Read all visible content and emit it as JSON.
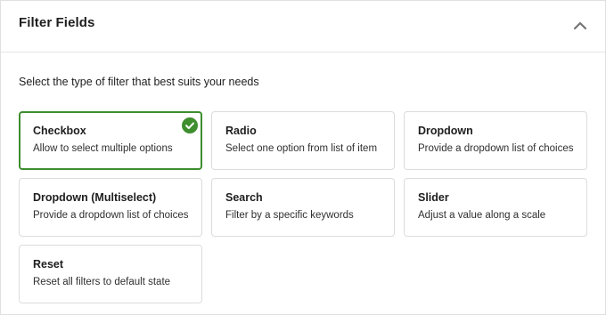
{
  "panel": {
    "title": "Filter Fields",
    "toggle_icon": "chevron-up-icon"
  },
  "intro_text": "Select the type of filter that best suits your needs",
  "selected_filter": "Checkbox",
  "colors": {
    "selected_border": "#3e8e2f",
    "check_badge": "#3e8e2f",
    "card_border": "#dcdcdc"
  },
  "filters": [
    {
      "title": "Checkbox",
      "description": "Allow to select multiple options",
      "selected": true
    },
    {
      "title": "Radio",
      "description": "Select one option from list of item",
      "selected": false
    },
    {
      "title": "Dropdown",
      "description": "Provide a dropdown list of choices",
      "selected": false
    },
    {
      "title": "Dropdown (Multiselect)",
      "description": "Provide a dropdown list of choices",
      "selected": false
    },
    {
      "title": "Search",
      "description": "Filter by a specific keywords",
      "selected": false
    },
    {
      "title": "Slider",
      "description": "Adjust a value along a scale",
      "selected": false
    },
    {
      "title": "Reset",
      "description": "Reset all filters to default state",
      "selected": false
    }
  ]
}
